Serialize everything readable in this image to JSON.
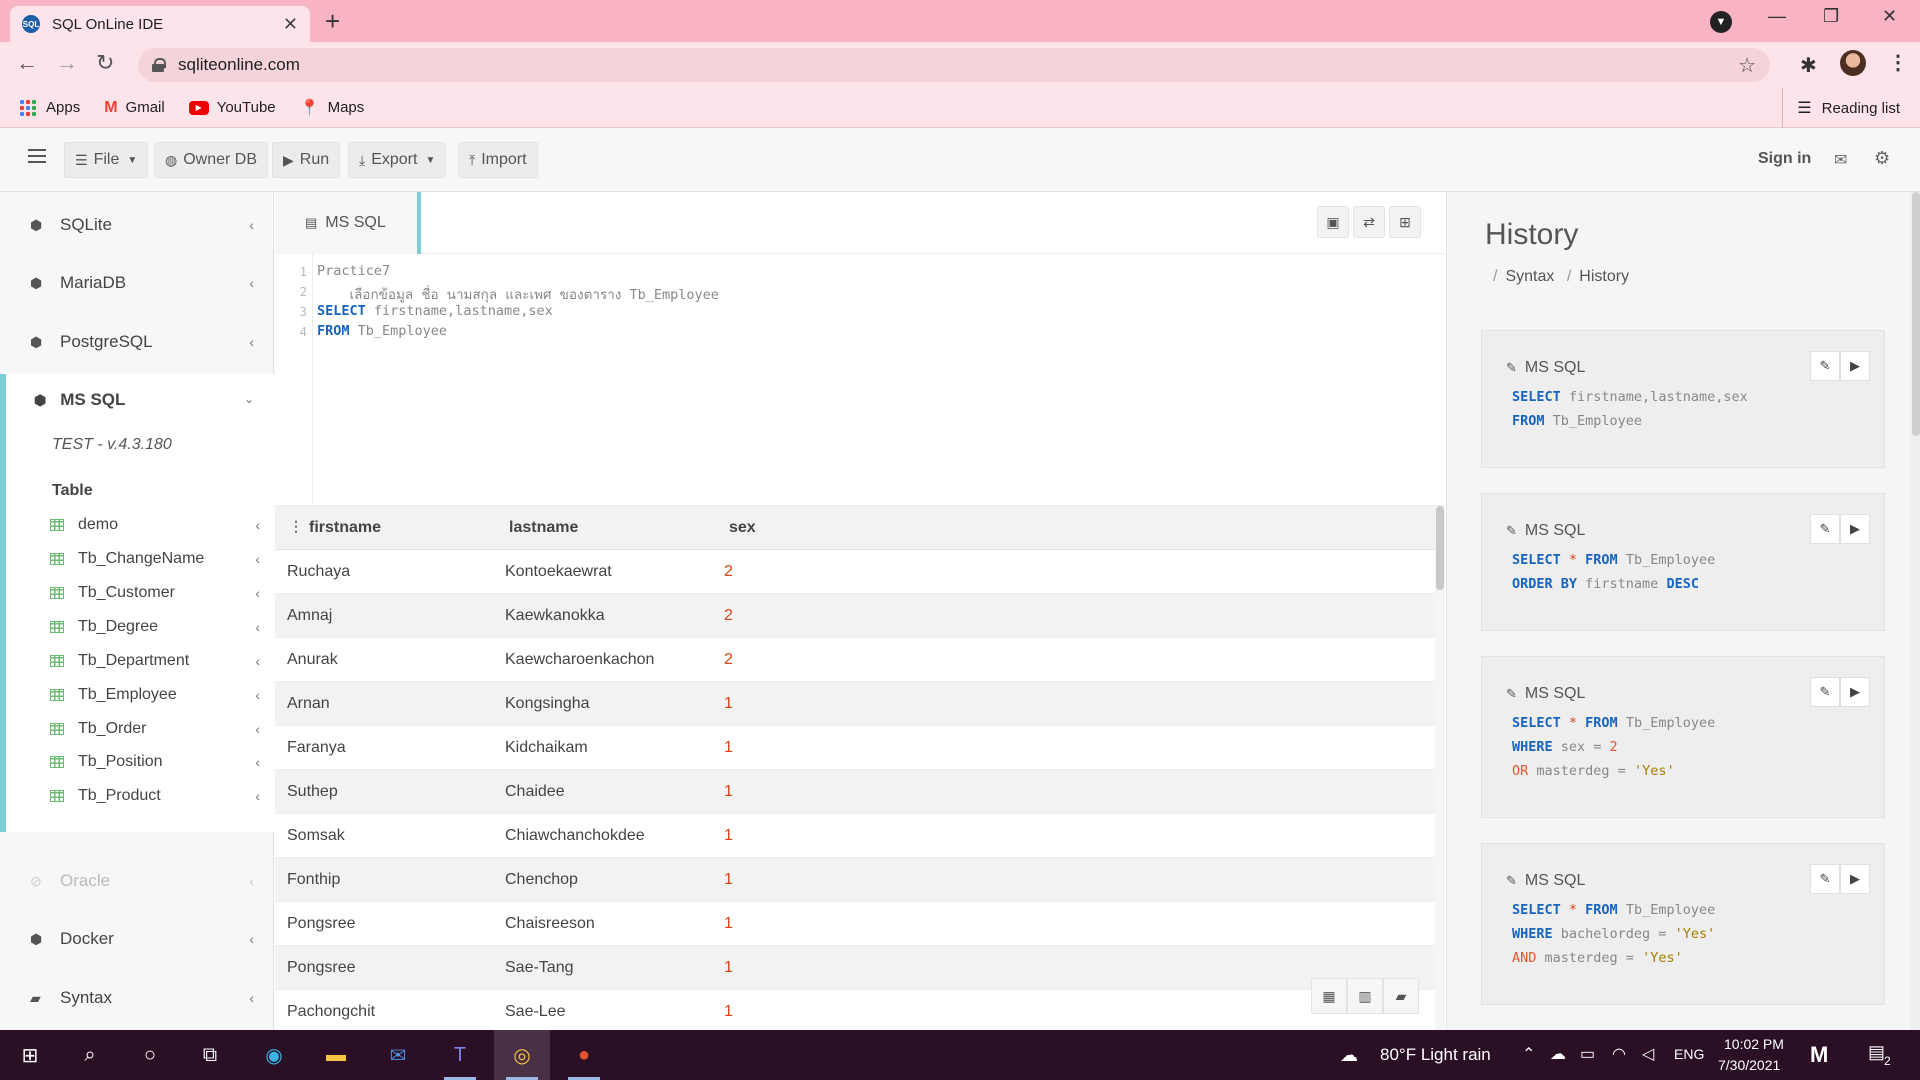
{
  "browser": {
    "tab_title": "SQL OnLine IDE",
    "tab_favicon": "SQL",
    "new_tab_icon": "+",
    "url": "sqliteonline.com",
    "bookmarks": [
      {
        "label": "Apps"
      },
      {
        "label": "Gmail"
      },
      {
        "label": "YouTube"
      },
      {
        "label": "Maps"
      }
    ],
    "reading_list": "Reading list"
  },
  "header": {
    "file": "File",
    "owner_db": "Owner DB",
    "run": "Run",
    "export": "Export",
    "import": "Import",
    "sign_in": "Sign in"
  },
  "sidebar": {
    "items_top": [
      {
        "label": "SQLite"
      },
      {
        "label": "MariaDB"
      },
      {
        "label": "PostgreSQL"
      }
    ],
    "active": {
      "label": "MS SQL",
      "version": "TEST - v.4.3.180",
      "table_heading": "Table",
      "tables": [
        "demo",
        "Tb_ChangeName",
        "Tb_Customer",
        "Tb_Degree",
        "Tb_Department",
        "Tb_Employee",
        "Tb_Order",
        "Tb_Position",
        "Tb_Product"
      ]
    },
    "items_bottom": [
      {
        "label": "Oracle"
      },
      {
        "label": "Docker"
      },
      {
        "label": "Syntax"
      }
    ]
  },
  "editor": {
    "tab_label": "MS SQL",
    "line_numbers": [
      "1",
      "2",
      "3",
      "4"
    ],
    "line1": "Practice7",
    "line2": "    เลือกข้อมูล ชื่อ นามสกุล และเพศ ของตาราง Tb_Employee",
    "line3_kw": "SELECT",
    "line3_rest": " firstname,lastname,sex",
    "line4_kw": "FROM",
    "line4_rest": " Tb_Employee"
  },
  "results": {
    "columns": [
      "firstname",
      "lastname",
      "sex"
    ],
    "rows": [
      [
        "Ruchaya",
        "Kontoekaewrat",
        "2"
      ],
      [
        "Amnaj",
        "Kaewkanokka",
        "2"
      ],
      [
        "Anurak",
        "Kaewcharoenkachon",
        "2"
      ],
      [
        "Arnan",
        "Kongsingha",
        "1"
      ],
      [
        "Faranya",
        "Kidchaikam",
        "1"
      ],
      [
        "Suthep",
        "Chaidee",
        "1"
      ],
      [
        "Somsak",
        "Chiawchanchokdee",
        "1"
      ],
      [
        "Fonthip",
        "Chenchop",
        "1"
      ],
      [
        "Pongsree",
        "Chaisreeson",
        "1"
      ],
      [
        "Pongsree",
        "Sae-Tang",
        "1"
      ],
      [
        "Pachongchit",
        "Sae-Lee",
        "1"
      ]
    ]
  },
  "history": {
    "title": "History",
    "crumbs": [
      "Syntax",
      "History"
    ],
    "cards": [
      {
        "db": "MS SQL",
        "l1a": "SELECT",
        "l1b": " firstname,lastname,sex",
        "l2a": "FROM",
        "l2b": " Tb_Employee"
      },
      {
        "db": "MS SQL",
        "l1a": "SELECT",
        "l1s": " * ",
        "l1c": "FROM",
        "l1d": " Tb_Employee",
        "l2a": "ORDER BY",
        "l2b": " firstname ",
        "l2c": "DESC"
      },
      {
        "db": "MS SQL",
        "l1a": "SELECT",
        "l1s": " * ",
        "l1c": "FROM",
        "l1d": " Tb_Employee",
        "l2a": "WHERE",
        "l2b": " sex = ",
        "l2c": "2",
        "l3a": "OR",
        "l3b": " masterdeg = ",
        "l3c": "'Yes'"
      },
      {
        "db": "MS SQL",
        "l1a": "SELECT",
        "l1s": " * ",
        "l1c": "FROM",
        "l1d": " Tb_Employee",
        "l2a": "WHERE",
        "l2b": " bachelordeg = ",
        "l2c": "'Yes'",
        "l3a": "AND",
        "l3b": " masterdeg = ",
        "l3c": "'Yes'"
      }
    ]
  },
  "taskbar": {
    "weather": "80°F  Light rain",
    "lang": "ENG",
    "time": "10:02 PM",
    "date": "7/30/2021",
    "notifications": "2"
  },
  "colors": {
    "titlebar": "#f8b4c2",
    "accent": "#7ccfd6",
    "keyword": "#1565c0",
    "number": "#d84315",
    "taskbar": "#2b0f24"
  }
}
